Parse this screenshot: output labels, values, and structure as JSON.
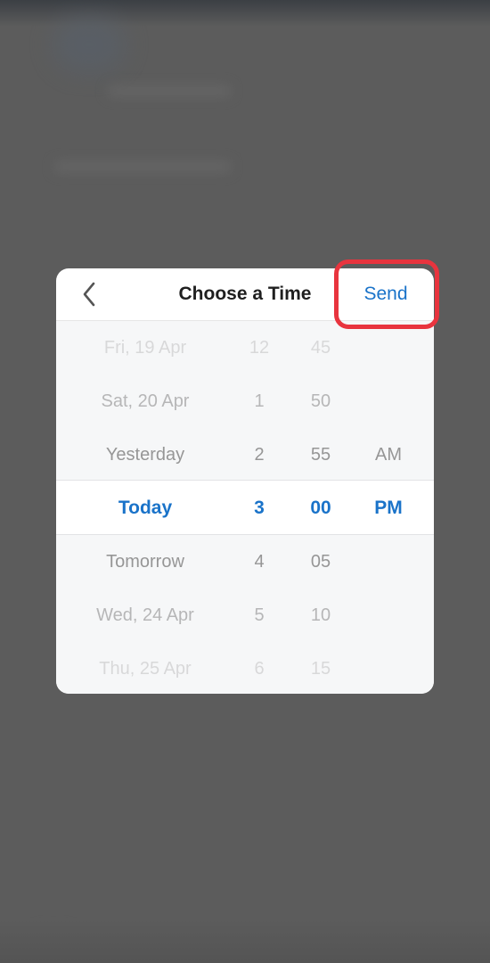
{
  "dialog": {
    "title": "Choose a Time",
    "send_label": "Send",
    "back_icon": "chevron-left-icon"
  },
  "picker": {
    "dates": [
      "Fri, 19 Apr",
      "Sat, 20 Apr",
      "Yesterday",
      "Today",
      "Tomorrow",
      "Wed, 24 Apr",
      "Thu, 25 Apr"
    ],
    "hours": [
      "12",
      "1",
      "2",
      "3",
      "4",
      "5",
      "6"
    ],
    "minutes": [
      "45",
      "50",
      "55",
      "00",
      "05",
      "10",
      "15"
    ],
    "periods": [
      "AM",
      "PM"
    ],
    "selected": {
      "date": "Today",
      "hour": "3",
      "minute": "00",
      "period": "PM"
    }
  },
  "colors": {
    "accent": "#1a73c9",
    "highlight_ring": "#e8343e",
    "backdrop": "#5c5c5c"
  }
}
